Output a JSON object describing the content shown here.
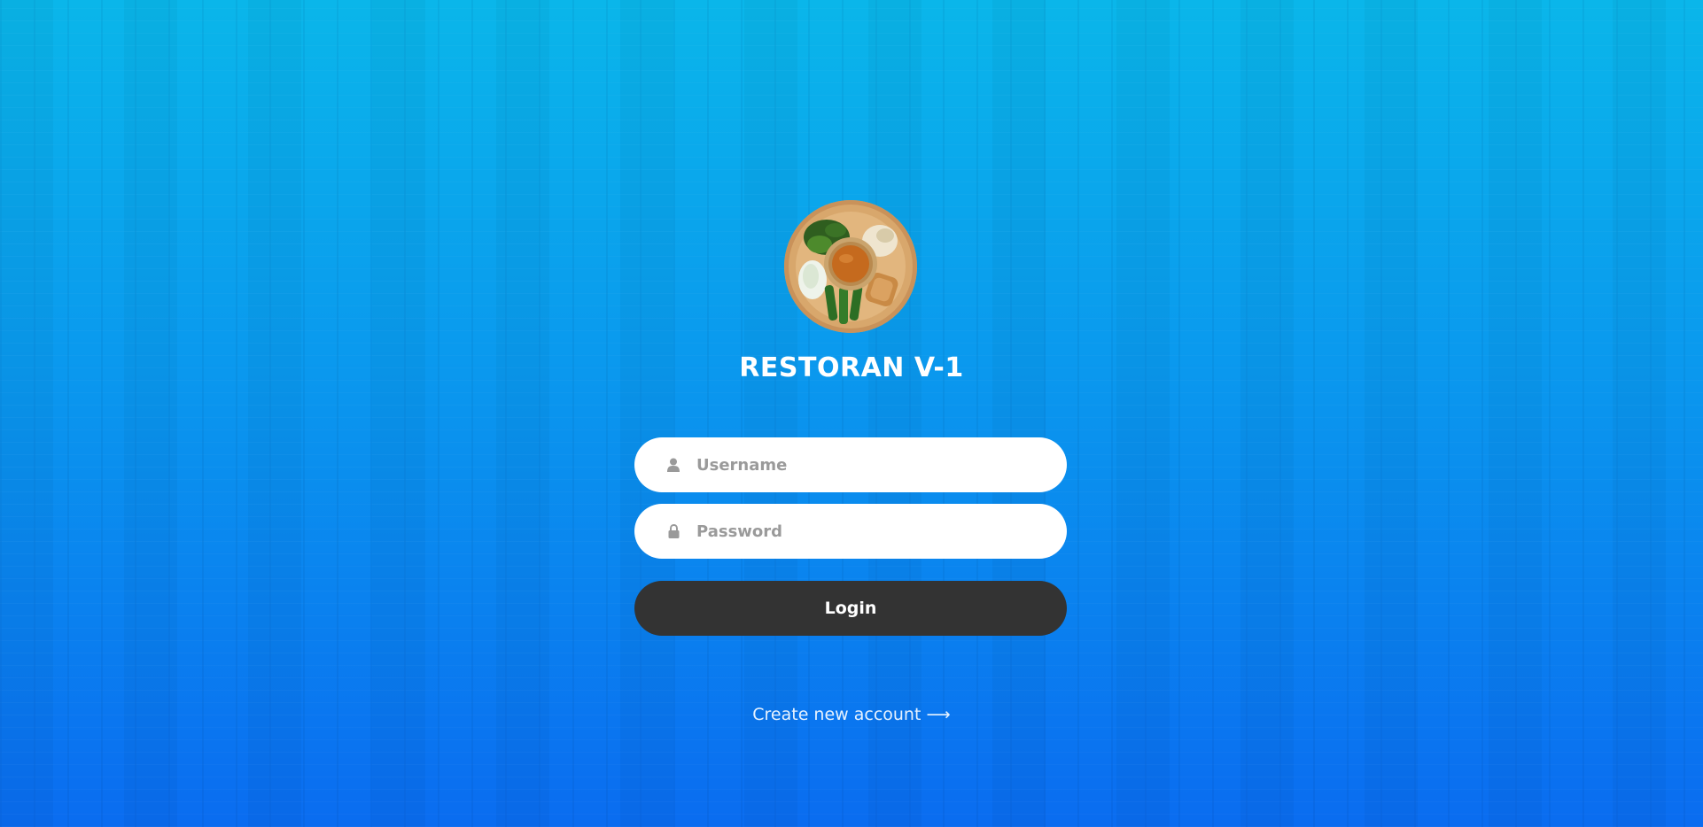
{
  "app": {
    "title": "RESTORAN V-1"
  },
  "logo": {
    "icon": "food-plate-logo"
  },
  "form": {
    "username": {
      "placeholder": "Username",
      "value": "",
      "icon": "user-icon"
    },
    "password": {
      "placeholder": "Password",
      "value": "",
      "icon": "lock-icon"
    },
    "login_label": "Login"
  },
  "footer": {
    "create_account_label": "Create new account",
    "arrow": "⟶"
  },
  "colors": {
    "background_top": "#0ab6ea",
    "background_bottom": "#0a6cf0",
    "button": "#333333",
    "input": "#ffffff",
    "title": "#ffffff"
  }
}
